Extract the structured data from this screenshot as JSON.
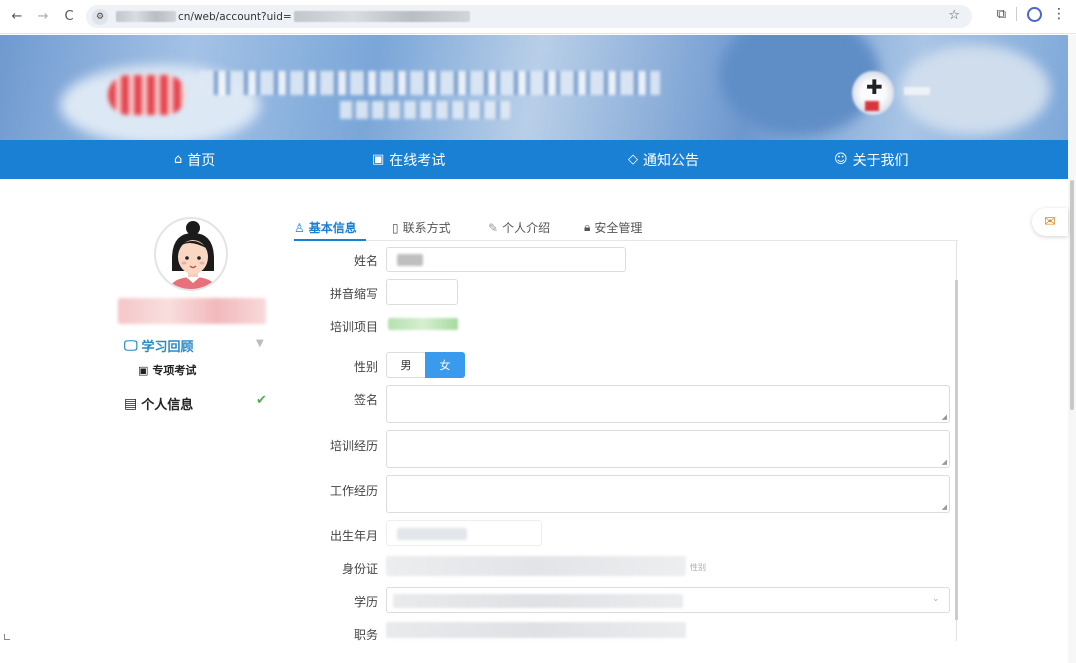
{
  "browser": {
    "url_visible": "cn/web/account?uid=",
    "nav_back": "←",
    "nav_forward": "→",
    "reload": "C",
    "star": "☆",
    "menu": "⋮"
  },
  "nav": {
    "home": "首页",
    "online_exam": "在线考试",
    "notice": "通知公告",
    "about": "关于我们"
  },
  "sidebar": {
    "study_review": "学习回顾",
    "special_exam": "专项考试",
    "personal_info": "个人信息"
  },
  "tabs": [
    "基本信息",
    "联系方式",
    "个人介绍",
    "安全管理"
  ],
  "form": {
    "name_label": "姓名",
    "pinyin_label": "拼音缩写",
    "project_label": "培训项目",
    "gender_label": "性别",
    "gender_male": "男",
    "gender_female": "女",
    "gender_selected": "女",
    "signature_label": "签名",
    "training_label": "培训经历",
    "work_label": "工作经历",
    "birth_label": "出生年月",
    "id_label": "身份证",
    "id_hint": "性别",
    "education_label": "学历",
    "position_label": "职务"
  },
  "colors": {
    "primary": "#1a80d4",
    "gender_active": "#3a9aee",
    "study_text": "#2a8ac9",
    "check": "#4caf50"
  }
}
